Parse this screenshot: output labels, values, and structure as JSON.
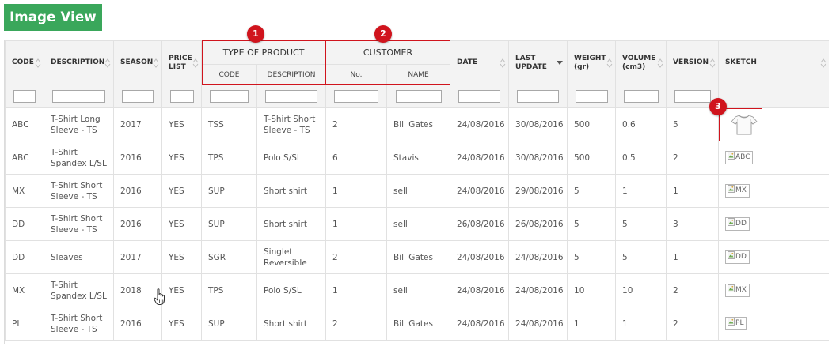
{
  "toolbar": {
    "image_view_label": "Image View"
  },
  "header": {
    "code": "CODE",
    "description": "DESCRIPTION",
    "season": "SEASON",
    "price_list_line1": "PRICE",
    "price_list_line2": "LIST",
    "type_of_product": "TYPE OF PRODUCT",
    "type_code": "CODE",
    "type_description": "DESCRIPTION",
    "customer": "CUSTOMER",
    "customer_no": "No.",
    "customer_name": "NAME",
    "date": "DATE",
    "last_update_line1": "LAST",
    "last_update_line2": "UPDATE",
    "weight_line1": "WEIGHT",
    "weight_line2": "(gr)",
    "volume_line1": "VOLUME",
    "volume_line2": "(cm3)",
    "version": "VERSION",
    "sketch": "SKETCH"
  },
  "callouts": {
    "one": "1",
    "two": "2",
    "three": "3"
  },
  "rows": [
    {
      "code": "ABC",
      "description": "T-Shirt Long Sleeve - TS",
      "season": "2017",
      "price_list": "YES",
      "type_code": "TSS",
      "type_description": "T-Shirt Short Sleeve - TS",
      "customer_no": "2",
      "customer_name": "Bill Gates",
      "date": "24/08/2016",
      "last_update": "30/08/2016",
      "weight": "500",
      "volume": "0.6",
      "version": "5",
      "sketch_alt": ""
    },
    {
      "code": "ABC",
      "description": "T-Shirt Spandex L/SL",
      "season": "2016",
      "price_list": "YES",
      "type_code": "TPS",
      "type_description": "Polo S/SL",
      "customer_no": "6",
      "customer_name": "Stavis",
      "date": "24/08/2016",
      "last_update": "30/08/2016",
      "weight": "500",
      "volume": "0.5",
      "version": "2",
      "sketch_alt": "ABC"
    },
    {
      "code": "MX",
      "description": "T-Shirt Short Sleeve - TS",
      "season": "2016",
      "price_list": "YES",
      "type_code": "SUP",
      "type_description": "Short shirt",
      "customer_no": "1",
      "customer_name": "sell",
      "date": "24/08/2016",
      "last_update": "29/08/2016",
      "weight": "5",
      "volume": "1",
      "version": "1",
      "sketch_alt": "MX"
    },
    {
      "code": "DD",
      "description": "T-Shirt Short Sleeve - TS",
      "season": "2016",
      "price_list": "YES",
      "type_code": "SUP",
      "type_description": "Short shirt",
      "customer_no": "1",
      "customer_name": "sell",
      "date": "26/08/2016",
      "last_update": "26/08/2016",
      "weight": "5",
      "volume": "5",
      "version": "3",
      "sketch_alt": "DD"
    },
    {
      "code": "DD",
      "description": "Sleaves",
      "season": "2017",
      "price_list": "YES",
      "type_code": "SGR",
      "type_description": "Singlet Reversible",
      "customer_no": "2",
      "customer_name": "Bill Gates",
      "date": "24/08/2016",
      "last_update": "24/08/2016",
      "weight": "5",
      "volume": "5",
      "version": "1",
      "sketch_alt": "DD"
    },
    {
      "code": "MX",
      "description": "T-Shirt Spandex L/SL",
      "season": "2018",
      "price_list": "YES",
      "type_code": "TPS",
      "type_description": "Polo S/SL",
      "customer_no": "1",
      "customer_name": "sell",
      "date": "24/08/2016",
      "last_update": "24/08/2016",
      "weight": "10",
      "volume": "10",
      "version": "2",
      "sketch_alt": "MX"
    },
    {
      "code": "PL",
      "description": "T-Shirt Short Sleeve - TS",
      "season": "2016",
      "price_list": "YES",
      "type_code": "SUP",
      "type_description": "Short shirt",
      "customer_no": "2",
      "customer_name": "Bill Gates",
      "date": "24/08/2016",
      "last_update": "24/08/2016",
      "weight": "1",
      "volume": "1",
      "version": "2",
      "sketch_alt": "PL"
    }
  ],
  "colors": {
    "accent_green": "#3aa75b",
    "callout_red": "#d0141d",
    "header_bg": "#f3f3f3"
  },
  "icons": {
    "sort": "sort-icon",
    "sort_desc": "sort-desc-icon",
    "cursor": "hand-cursor-icon",
    "broken_image": "broken-image-icon",
    "sketch": "tshirt-sketch-icon"
  }
}
